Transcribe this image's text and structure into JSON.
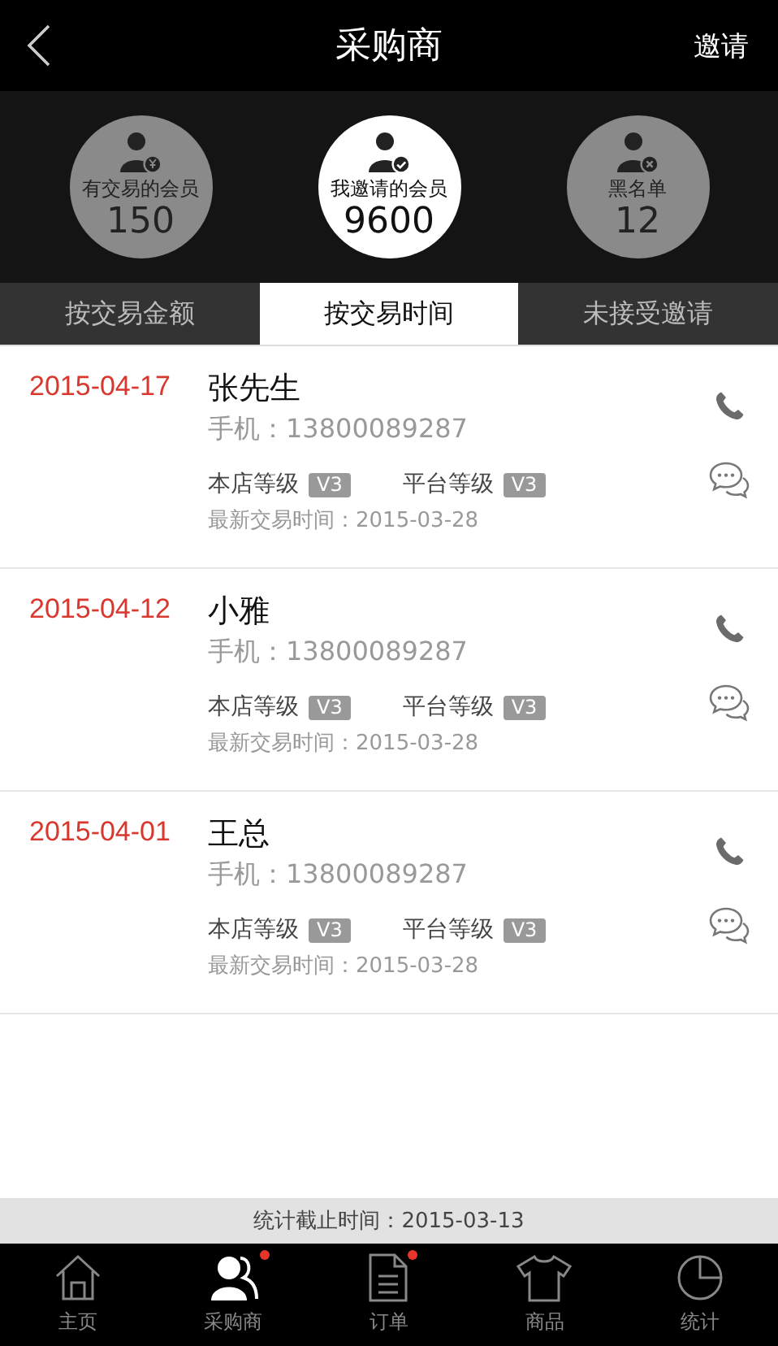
{
  "header": {
    "title": "采购商",
    "action": "邀请"
  },
  "stats": [
    {
      "kind": "traded",
      "label": "有交易的会员",
      "count": "150",
      "selected": false
    },
    {
      "kind": "invited",
      "label": "我邀请的会员",
      "count": "9600",
      "selected": true
    },
    {
      "kind": "blocked",
      "label": "黑名单",
      "count": "12",
      "selected": false
    }
  ],
  "tabs": [
    {
      "label": "按交易金额",
      "selected": false
    },
    {
      "label": "按交易时间",
      "selected": true
    },
    {
      "label": "未接受邀请",
      "selected": false
    }
  ],
  "members": [
    {
      "date": "2015-04-17",
      "name": "张先生",
      "phone": "手机：13800089287",
      "store_level_label": "本店等级",
      "store_level": "V3",
      "platform_level_label": "平台等级",
      "platform_level": "V3",
      "last_trade": "最新交易时间：2015-03-28"
    },
    {
      "date": "2015-04-12",
      "name": "小雅",
      "phone": "手机：13800089287",
      "store_level_label": "本店等级",
      "store_level": "V3",
      "platform_level_label": "平台等级",
      "platform_level": "V3",
      "last_trade": "最新交易时间：2015-03-28"
    },
    {
      "date": "2015-04-01",
      "name": "王总",
      "phone": "手机：13800089287",
      "store_level_label": "本店等级",
      "store_level": "V3",
      "platform_level_label": "平台等级",
      "platform_level": "V3",
      "last_trade": "最新交易时间：2015-03-28"
    }
  ],
  "footer_note": "统计截止时间：2015-03-13",
  "nav": [
    {
      "kind": "home",
      "label": "主页",
      "selected": false,
      "badge": false
    },
    {
      "kind": "buyers",
      "label": "采购商",
      "selected": true,
      "badge": true
    },
    {
      "kind": "orders",
      "label": "订单",
      "selected": false,
      "badge": true
    },
    {
      "kind": "products",
      "label": "商品",
      "selected": false,
      "badge": false
    },
    {
      "kind": "stats",
      "label": "统计",
      "selected": false,
      "badge": false
    }
  ]
}
